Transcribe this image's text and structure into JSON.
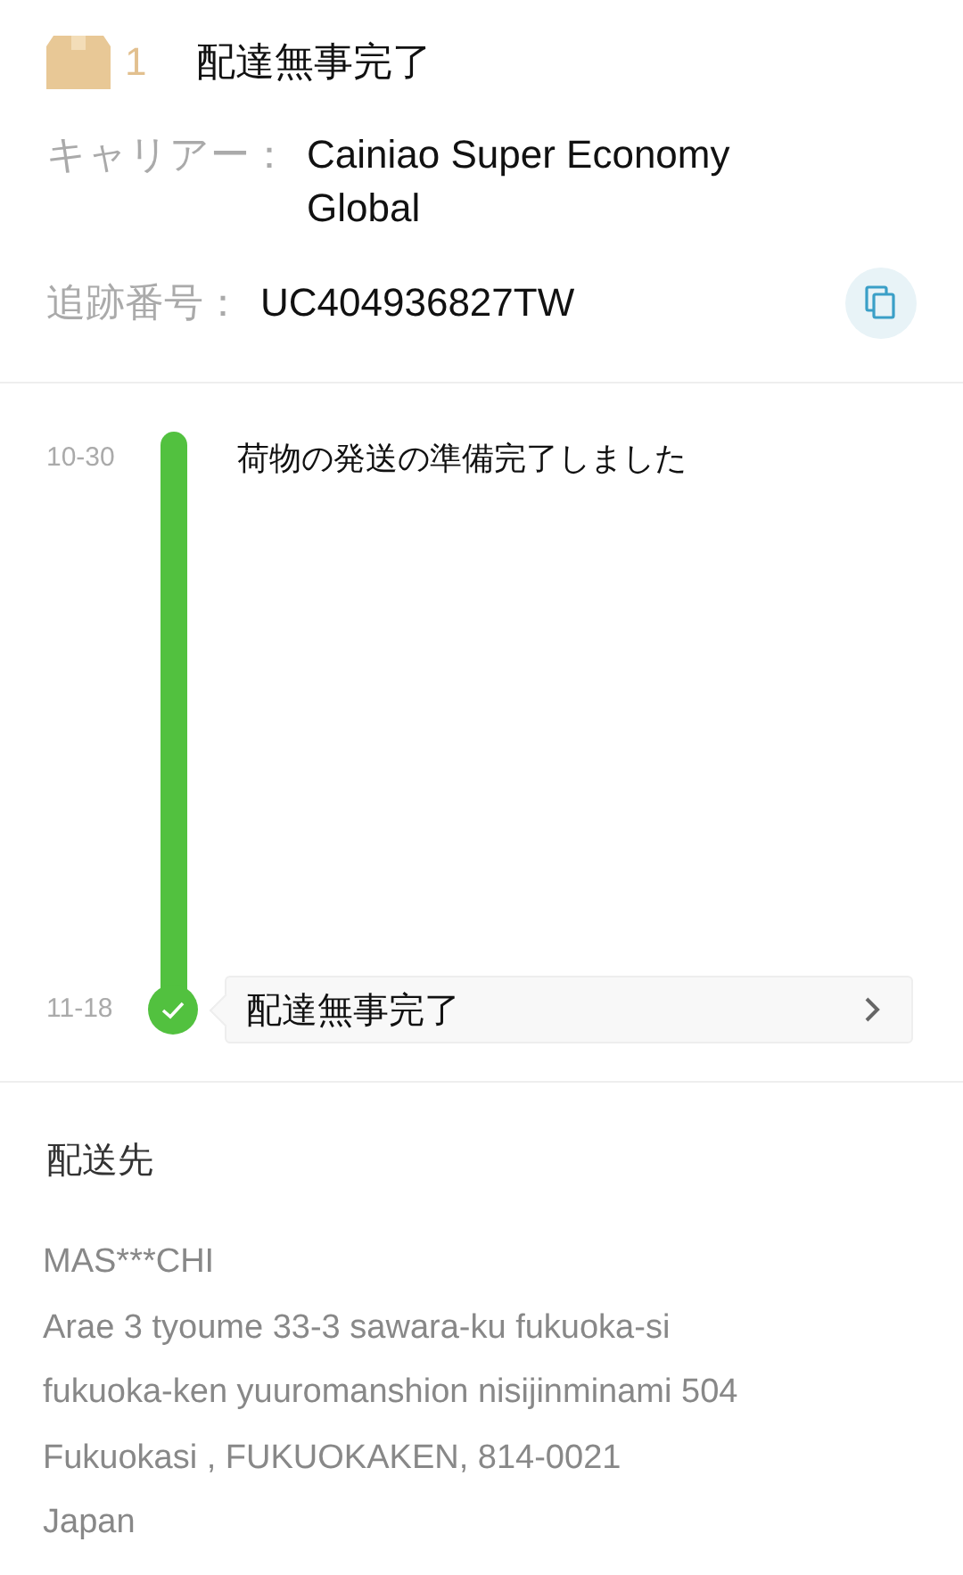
{
  "header": {
    "count": "1",
    "status": "配達無事完了"
  },
  "carrier": {
    "label": "キャリアー：",
    "value": "Cainiao Super Economy Global"
  },
  "tracking": {
    "label": "追跡番号：",
    "value": "UC404936827TW"
  },
  "timeline": [
    {
      "kind": "plain",
      "date": "10-30",
      "text": "荷物の発送の準備完了しました"
    },
    {
      "kind": "card",
      "date": "11-18",
      "text": "配達無事完了"
    }
  ],
  "destination": {
    "title": "配送先",
    "lines": [
      "MAS***CHI",
      "Arae 3 tyoume 33-3 sawara-ku fukuoka-si",
      "fukuoka-ken yuuromanshion nisijinminami 504",
      "Fukuokasi , FUKUOKAKEN, 814-0021",
      "Japan"
    ]
  }
}
